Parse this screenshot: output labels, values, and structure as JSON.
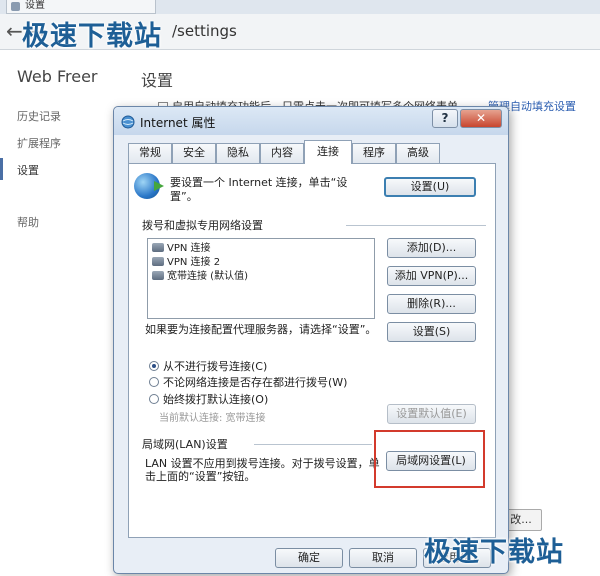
{
  "browser": {
    "tab_title": "设置",
    "address": "/settings",
    "app_name": "Web Freer",
    "page_heading": "设置",
    "nav_items": [
      "历史记录",
      "扩展程序",
      "设置",
      "帮助"
    ],
    "autofill_row": "启用自动填充功能后，只需点击一次即可填写多个网络表单。",
    "autofill_link": "管理自动填充设置",
    "partial_button": "改..."
  },
  "watermark": "极速下载站",
  "dialog": {
    "title": "Internet 属性",
    "help": "?",
    "close": "✕",
    "tabs": [
      "常规",
      "安全",
      "隐私",
      "内容",
      "连接",
      "程序",
      "高级"
    ],
    "active_tab": "连接",
    "intro_text": "要设置一个 Internet 连接，单击“设置”。",
    "setup_button": "设置(U)",
    "dialup_group": "拨号和虚拟专用网络设置",
    "connections": [
      "VPN 连接",
      "VPN 连接 2",
      "宽带连接 (默认值)"
    ],
    "add_button": "添加(D)...",
    "add_vpn_button": "添加 VPN(P)...",
    "remove_button": "删除(R)...",
    "proxy_text": "如果要为连接配置代理服务器，请选择“设置”。",
    "settings_button": "设置(S)",
    "radio_options": [
      "从不进行拨号连接(C)",
      "不论网络连接是否存在都进行拨号(W)",
      "始终拨打默认连接(O)"
    ],
    "selected_radio": 0,
    "current_default_label": "当前默认连接: 宽带连接",
    "set_default_button": "设置默认值(E)",
    "lan_group": "局域网(LAN)设置",
    "lan_text": "LAN 设置不应用到拨号连接。对于拨号设置，单击上面的“设置”按钮。",
    "lan_button": "局域网设置(L)",
    "ok_button": "确定",
    "cancel_button": "取消",
    "apply_button": "应用(A)"
  },
  "colors": {
    "highlight": "#d33a2c",
    "link": "#2a5db0",
    "watermark": "#1e5f96"
  }
}
